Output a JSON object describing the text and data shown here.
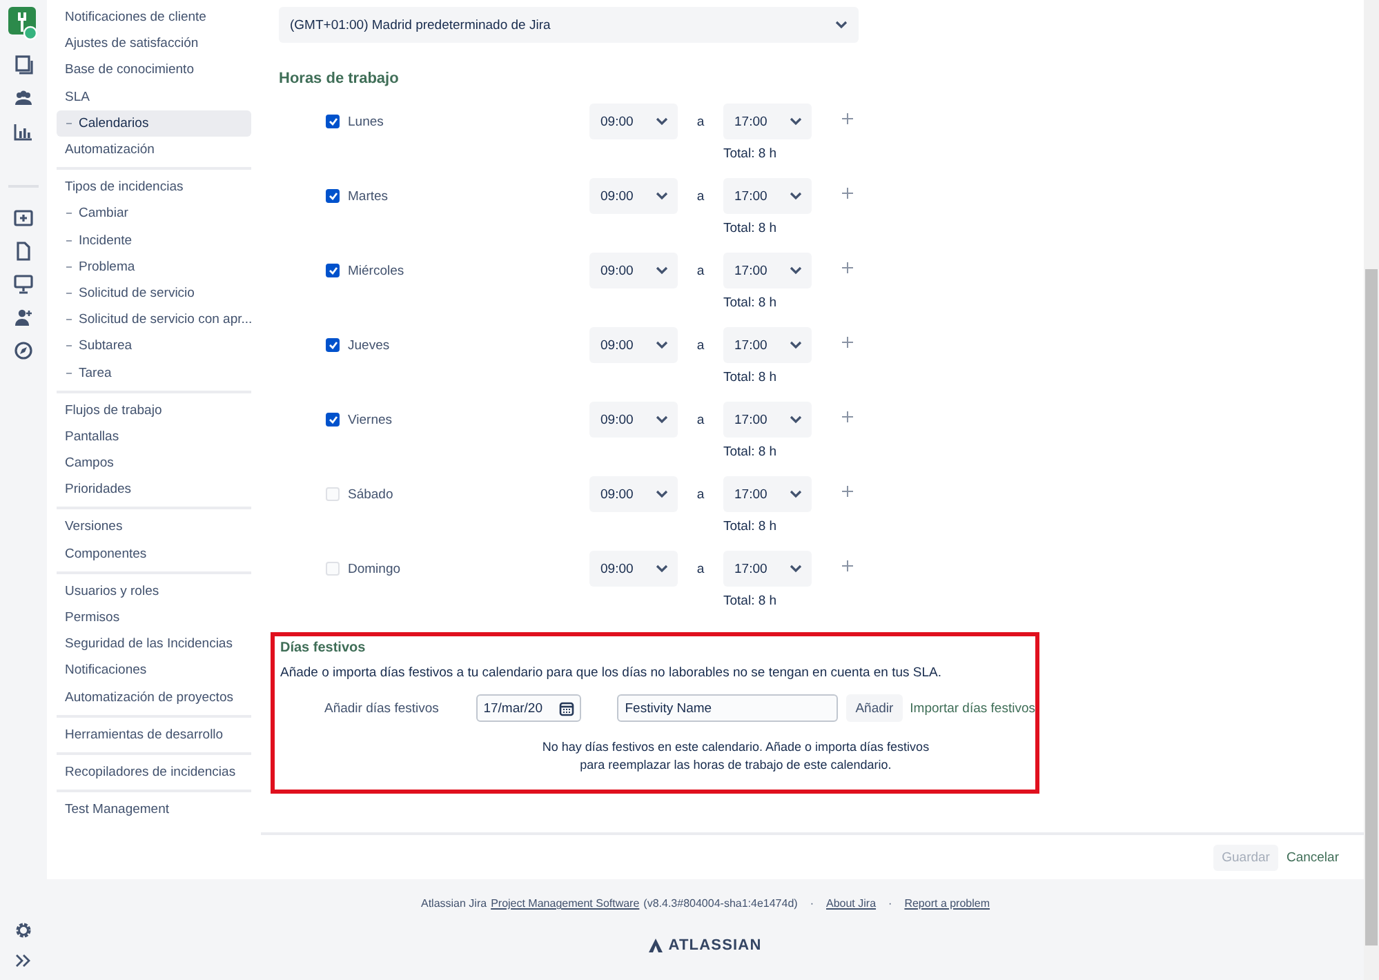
{
  "sidebar": {
    "sections": [
      {
        "items": [
          {
            "label": "Notificaciones de cliente",
            "kind": "item",
            "selected": false
          },
          {
            "label": "Ajustes de satisfacción",
            "kind": "item",
            "selected": false
          },
          {
            "label": "Base de conocimiento",
            "kind": "item",
            "selected": false
          },
          {
            "label": "SLA",
            "kind": "item",
            "selected": false
          },
          {
            "label": "Calendarios",
            "kind": "sub",
            "selected": true
          },
          {
            "label": "Automatización",
            "kind": "item",
            "selected": false
          }
        ]
      },
      {
        "items": [
          {
            "label": "Tipos de incidencias",
            "kind": "item",
            "selected": false
          },
          {
            "label": "Cambiar",
            "kind": "sub",
            "selected": false
          },
          {
            "label": "Incidente",
            "kind": "sub",
            "selected": false
          },
          {
            "label": "Problema",
            "kind": "sub",
            "selected": false
          },
          {
            "label": "Solicitud de servicio",
            "kind": "sub",
            "selected": false
          },
          {
            "label": "Solicitud de servicio con apr...",
            "kind": "sub",
            "selected": false
          },
          {
            "label": "Subtarea",
            "kind": "sub",
            "selected": false
          },
          {
            "label": "Tarea",
            "kind": "sub",
            "selected": false
          }
        ]
      },
      {
        "items": [
          {
            "label": "Flujos de trabajo",
            "kind": "item",
            "selected": false
          },
          {
            "label": "Pantallas",
            "kind": "item",
            "selected": false
          },
          {
            "label": "Campos",
            "kind": "item",
            "selected": false
          },
          {
            "label": "Prioridades",
            "kind": "item",
            "selected": false
          }
        ]
      },
      {
        "items": [
          {
            "label": "Versiones",
            "kind": "item",
            "selected": false
          },
          {
            "label": "Componentes",
            "kind": "item",
            "selected": false
          }
        ]
      },
      {
        "items": [
          {
            "label": "Usuarios y roles",
            "kind": "item",
            "selected": false
          },
          {
            "label": "Permisos",
            "kind": "item",
            "selected": false
          },
          {
            "label": "Seguridad de las Incidencias",
            "kind": "item",
            "selected": false
          },
          {
            "label": "Notificaciones",
            "kind": "item",
            "selected": false
          },
          {
            "label": "Automatización de proyectos",
            "kind": "item",
            "selected": false
          }
        ]
      },
      {
        "items": [
          {
            "label": "Herramientas de desarrollo",
            "kind": "item",
            "selected": false
          }
        ]
      },
      {
        "items": [
          {
            "label": "Recopiladores de incidencias",
            "kind": "item",
            "selected": false
          }
        ]
      },
      {
        "items": [
          {
            "label": "Test Management",
            "kind": "item",
            "selected": false
          }
        ]
      }
    ]
  },
  "timezone": {
    "value": "(GMT+01:00) Madrid predeterminado de Jira"
  },
  "working_hours": {
    "title": "Horas de trabajo",
    "days": [
      {
        "day": "Lunes",
        "checked": true,
        "start": "09:00",
        "to": "a",
        "end": "17:00",
        "total": "Total: 8 h"
      },
      {
        "day": "Martes",
        "checked": true,
        "start": "09:00",
        "to": "a",
        "end": "17:00",
        "total": "Total: 8 h"
      },
      {
        "day": "Miércoles",
        "checked": true,
        "start": "09:00",
        "to": "a",
        "end": "17:00",
        "total": "Total: 8 h"
      },
      {
        "day": "Jueves",
        "checked": true,
        "start": "09:00",
        "to": "a",
        "end": "17:00",
        "total": "Total: 8 h"
      },
      {
        "day": "Viernes",
        "checked": true,
        "start": "09:00",
        "to": "a",
        "end": "17:00",
        "total": "Total: 8 h"
      },
      {
        "day": "Sábado",
        "checked": false,
        "start": "09:00",
        "to": "a",
        "end": "17:00",
        "total": "Total: 8 h"
      },
      {
        "day": "Domingo",
        "checked": false,
        "start": "09:00",
        "to": "a",
        "end": "17:00",
        "total": "Total: 8 h"
      }
    ]
  },
  "holidays": {
    "title": "Días festivos",
    "description": "Añade o importa días festivos a tu calendario para que los días no laborables no se tengan en cuenta en tus SLA.",
    "add_label": "Añadir días festivos",
    "date": "17/mar/20",
    "name": "Festivity Name",
    "add_button": "Añadir",
    "import_link": "Importar días festivos",
    "empty_message": "No hay días festivos en este calendario. Añade o importa días festivos para reemplazar las horas de trabajo de este calendario."
  },
  "actions": [
    {
      "label": "Guardar",
      "kind": "button",
      "disabled": true
    },
    {
      "label": "Cancelar",
      "kind": "link",
      "disabled": false
    }
  ],
  "footer": {
    "product": "Atlassian Jira",
    "link": "Project Management Software",
    "version": "(v8.4.3#804004-sha1:4e1474d)",
    "separators": [
      "·",
      "·"
    ],
    "links": [
      "About Jira",
      "Report a problem"
    ],
    "logo": "ATLASSIAN"
  }
}
